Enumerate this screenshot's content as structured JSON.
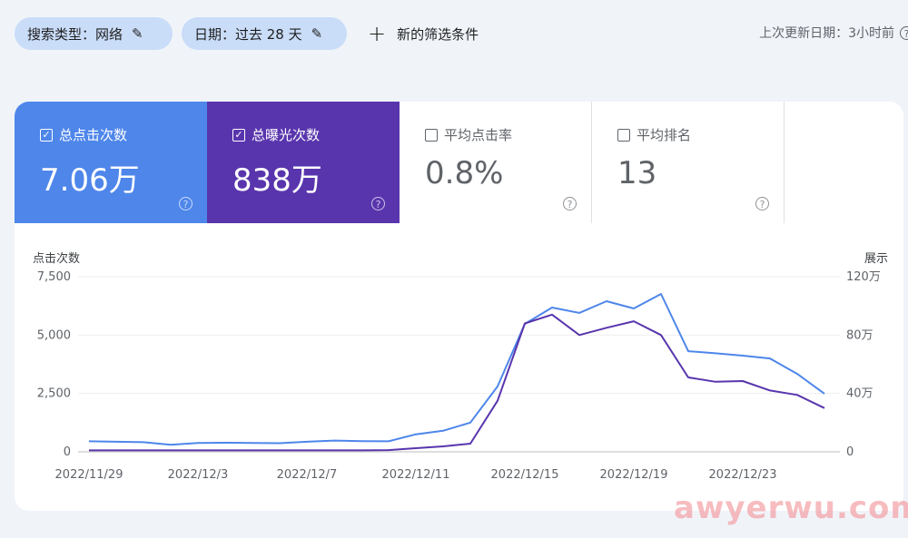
{
  "filters": [
    {
      "label": "搜索类型：网络"
    },
    {
      "label": "日期：过去 28 天"
    }
  ],
  "add_filter": "新的筛选条件",
  "last_updated": "上次更新日期：3小时前",
  "metrics": [
    {
      "label": "总点击次数",
      "value": "7.06万",
      "checked": true
    },
    {
      "label": "总曝光次数",
      "value": "838万",
      "checked": true
    },
    {
      "label": "平均点击率",
      "value": "0.8%",
      "checked": false
    },
    {
      "label": "平均排名",
      "value": "13",
      "checked": false
    }
  ],
  "watermark": "awyerwu.com",
  "colors": {
    "clicks": "#4e86ea",
    "impressions": "#5935ad"
  },
  "chart_data": {
    "type": "line",
    "ylabel": "点击次数",
    "y2label": "展示",
    "ylim": [
      0,
      7500
    ],
    "y2lim": [
      0,
      1200000
    ],
    "yticks": [
      "0",
      "2,500",
      "5,000",
      "7,500"
    ],
    "y2ticks": [
      "0",
      "40万",
      "80万",
      "120万"
    ],
    "xticks": [
      "2022/11/29",
      "2022/12/3",
      "2022/12/7",
      "2022/12/11",
      "2022/12/15",
      "2022/12/19",
      "2022/12/23"
    ],
    "x": [
      "11/29",
      "11/30",
      "12/1",
      "12/2",
      "12/3",
      "12/4",
      "12/5",
      "12/6",
      "12/7",
      "12/8",
      "12/9",
      "12/10",
      "12/11",
      "12/12",
      "12/13",
      "12/14",
      "12/15",
      "12/16",
      "12/17",
      "12/18",
      "12/19",
      "12/20",
      "12/21",
      "12/22",
      "12/23",
      "12/24",
      "12/25",
      "12/26"
    ],
    "series": [
      {
        "name": "点击次数",
        "axis": "left",
        "values": [
          450,
          430,
          410,
          300,
          380,
          390,
          380,
          370,
          430,
          480,
          460,
          450,
          750,
          900,
          1250,
          2800,
          5480,
          6180,
          5950,
          6450,
          6140,
          6760,
          4310,
          4220,
          4120,
          4000,
          3340,
          2490
        ]
      },
      {
        "name": "展示",
        "axis": "right",
        "values": [
          10000,
          10000,
          10000,
          10000,
          10000,
          10000,
          10000,
          10000,
          10000,
          10000,
          10000,
          12000,
          25000,
          37000,
          56000,
          350000,
          880000,
          940000,
          800000,
          850000,
          895000,
          800000,
          510000,
          480000,
          485000,
          420000,
          390000,
          300000
        ]
      }
    ]
  }
}
